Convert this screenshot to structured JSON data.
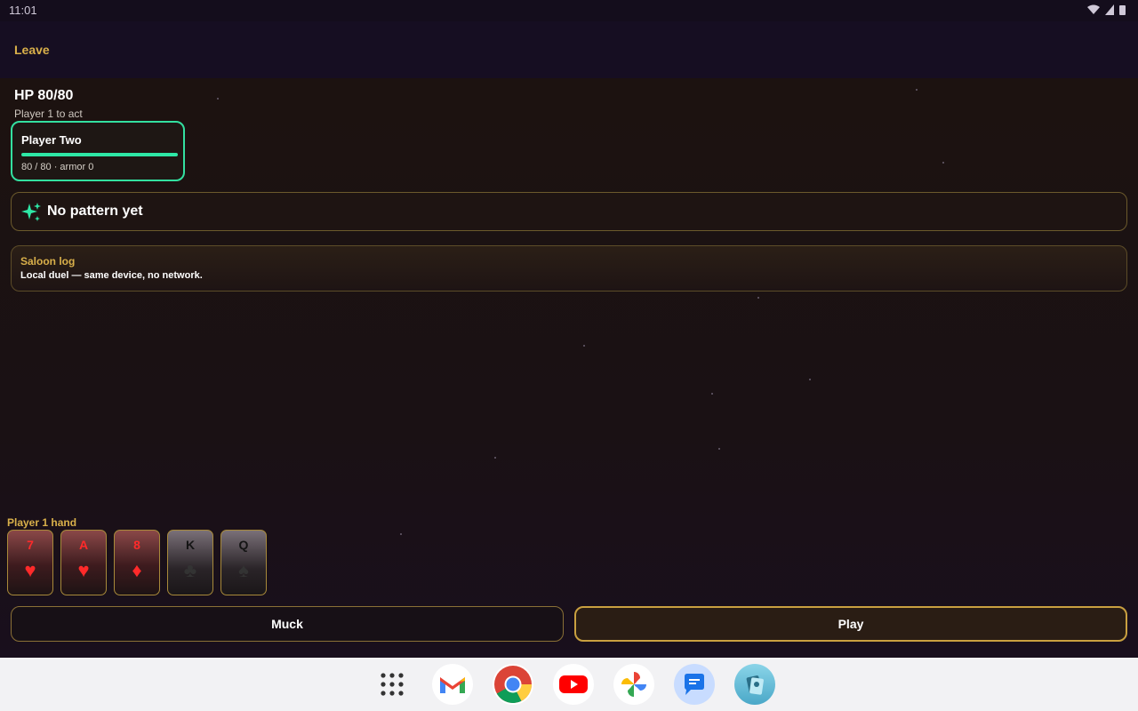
{
  "status": {
    "time": "11:01"
  },
  "header": {
    "leave_label": "Leave"
  },
  "player": {
    "hp_text": "HP 80/80",
    "turn_text": "Player 1 to act"
  },
  "opponent": {
    "name": "Player Two",
    "stats": "80 / 80 · armor 0",
    "hp_fraction": 1.0
  },
  "pattern": {
    "text": "No pattern yet"
  },
  "log": {
    "title": "Saloon log",
    "entry": "Local duel — same device, no network."
  },
  "hand": {
    "label": "Player 1 hand",
    "cards": [
      {
        "rank": "7",
        "suit": "♥",
        "color": "red"
      },
      {
        "rank": "A",
        "suit": "♥",
        "color": "red"
      },
      {
        "rank": "8",
        "suit": "♦",
        "color": "red"
      },
      {
        "rank": "K",
        "suit": "♣",
        "color": "black"
      },
      {
        "rank": "Q",
        "suit": "♠",
        "color": "black"
      }
    ]
  },
  "actions": {
    "muck_label": "Muck",
    "play_label": "Play"
  },
  "dock": [
    {
      "icon": "app-drawer-icon"
    },
    {
      "icon": "gmail-icon"
    },
    {
      "icon": "chrome-icon"
    },
    {
      "icon": "youtube-icon"
    },
    {
      "icon": "photos-icon"
    },
    {
      "icon": "messages-icon"
    },
    {
      "icon": "game-app-icon"
    }
  ],
  "colors": {
    "accent": "#d9b04a",
    "hp": "#2ee8a6",
    "background": "#1a0f14"
  }
}
